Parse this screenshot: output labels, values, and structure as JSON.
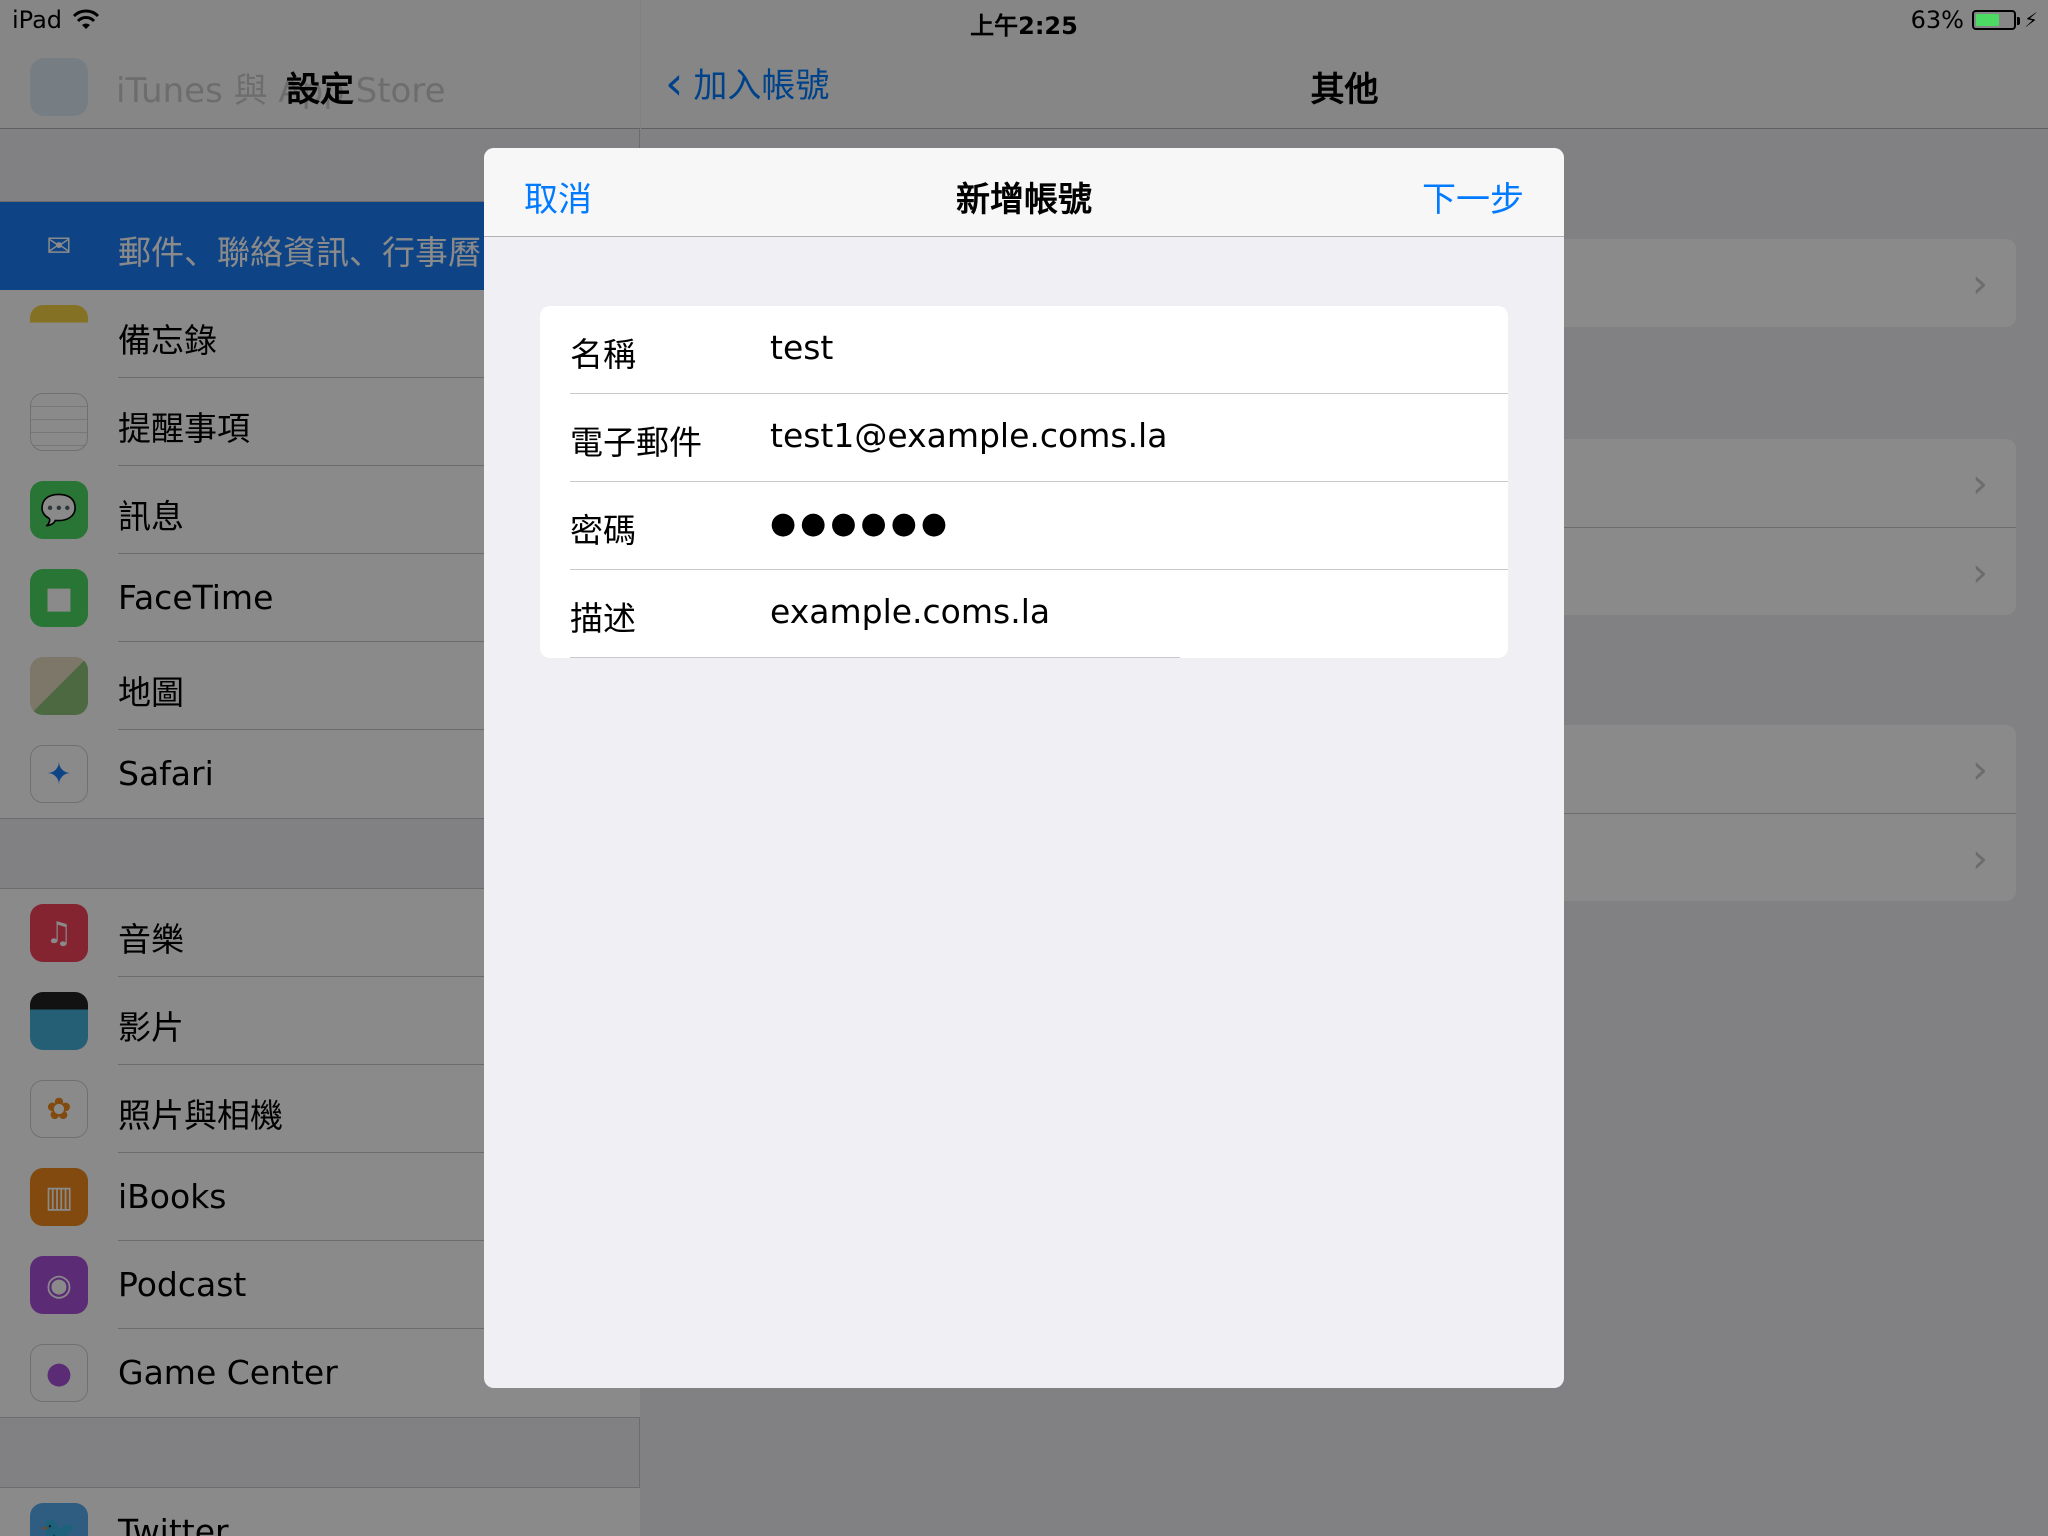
{
  "status_bar": {
    "device": "iPad",
    "time": "上午2:25",
    "battery_percent": "63%",
    "battery_level": 0.63
  },
  "master": {
    "title": "設定",
    "ghost_item": "iTunes 與 App Store",
    "groups": [
      [
        {
          "label": "郵件、聯絡資訊、行事曆",
          "icon": "mail-icon",
          "color": "#1a7ef5",
          "selected": true
        },
        {
          "label": "備忘錄",
          "icon": "notes-icon",
          "color": "#f5d141"
        },
        {
          "label": "提醒事項",
          "icon": "reminders-icon",
          "color": "#ffffff"
        },
        {
          "label": "訊息",
          "icon": "messages-icon",
          "color": "#4cd964"
        },
        {
          "label": "FaceTime",
          "icon": "facetime-icon",
          "color": "#4cd964"
        },
        {
          "label": "地圖",
          "icon": "maps-icon",
          "color": "#e6dcc3"
        },
        {
          "label": "Safari",
          "icon": "safari-icon",
          "color": "#ffffff"
        }
      ],
      [
        {
          "label": "音樂",
          "icon": "music-icon",
          "color": "#f2435a"
        },
        {
          "label": "影片",
          "icon": "videos-icon",
          "color": "#45b0d9"
        },
        {
          "label": "照片與相機",
          "icon": "photos-icon",
          "color": "#ffffff"
        },
        {
          "label": "iBooks",
          "icon": "ibooks-icon",
          "color": "#f08a1c"
        },
        {
          "label": "Podcast",
          "icon": "podcast-icon",
          "color": "#a950d9"
        },
        {
          "label": "Game Center",
          "icon": "game-center-icon",
          "color": "#ffffff"
        }
      ],
      [
        {
          "label": "Twitter",
          "icon": "twitter-icon",
          "color": "#55acee"
        }
      ]
    ]
  },
  "detail": {
    "back_label": "加入帳號",
    "title": "其他"
  },
  "modal": {
    "cancel_label": "取消",
    "title": "新增帳號",
    "next_label": "下一步",
    "fields": [
      {
        "label": "名稱",
        "value": "test"
      },
      {
        "label": "電子郵件",
        "value": "test1@example.coms.la"
      },
      {
        "label": "密碼",
        "value": "●●●●●●"
      },
      {
        "label": "描述",
        "value": "example.coms.la"
      }
    ]
  },
  "colors": {
    "accent": "#007aff",
    "selected_row": "#1a7ef5",
    "background": "#efeff4"
  }
}
